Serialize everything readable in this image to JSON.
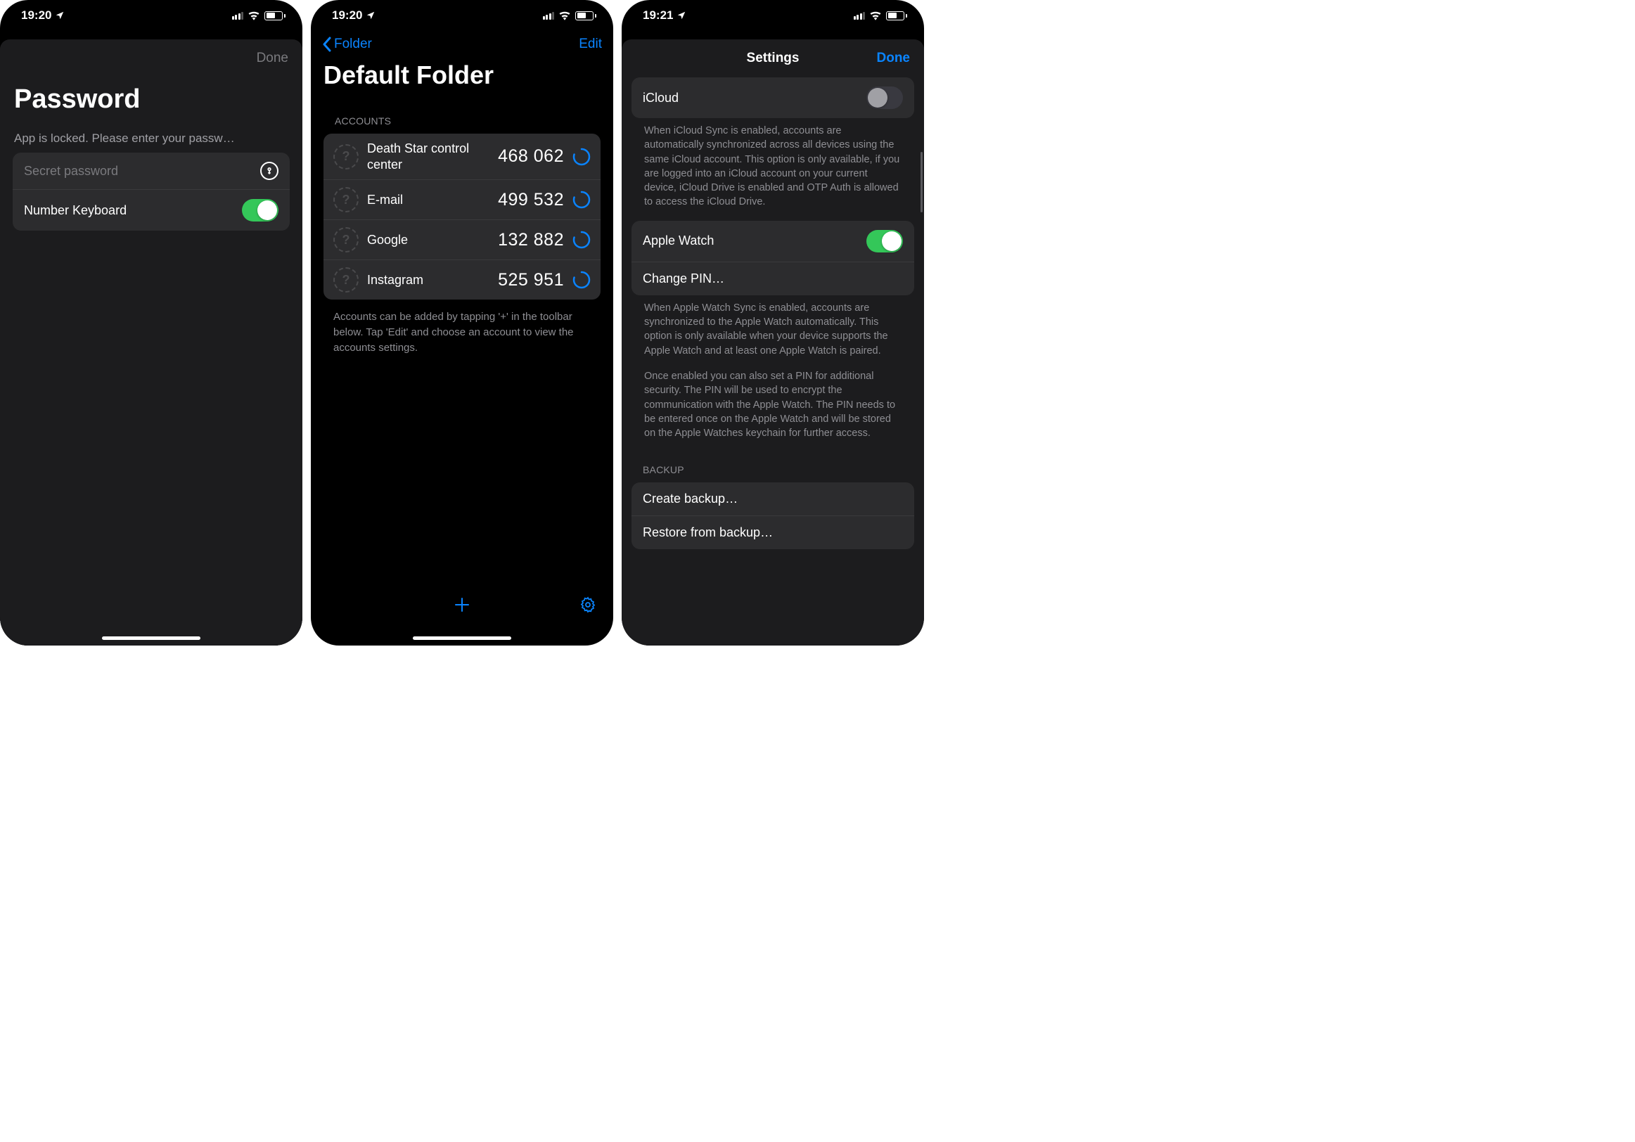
{
  "screen1": {
    "time": "19:20",
    "done": "Done",
    "title": "Password",
    "subtitle": "App is locked. Please enter your passw…",
    "placeholder": "Secret password",
    "numKeyboardLabel": "Number Keyboard"
  },
  "screen2": {
    "time": "19:20",
    "back": "Folder",
    "edit": "Edit",
    "title": "Default Folder",
    "sectionHeader": "ACCOUNTS",
    "accounts": [
      {
        "name": "Death Star control center",
        "code": "468 062"
      },
      {
        "name": "E-mail",
        "code": "499 532"
      },
      {
        "name": "Google",
        "code": "132 882"
      },
      {
        "name": "Instagram",
        "code": "525 951"
      }
    ],
    "footer": "Accounts can be added by tapping '+' in the toolbar below. Tap 'Edit' and choose an account to view the accounts settings."
  },
  "screen3": {
    "time": "19:21",
    "title": "Settings",
    "done": "Done",
    "icloudLabel": "iCloud",
    "icloudDesc": "When iCloud Sync is enabled, accounts are automatically synchronized across all devices using the same iCloud account. This option is only available, if you are logged into an iCloud account on your current device, iCloud Drive is enabled and OTP Auth is allowed to access the iCloud Drive.",
    "appleWatchLabel": "Apple Watch",
    "changePinLabel": "Change PIN…",
    "watchDesc1": "When Apple Watch Sync is enabled, accounts are synchronized to the Apple Watch automatically. This option is only available when your device supports the Apple Watch and at least one Apple Watch is paired.",
    "watchDesc2": "Once enabled you can also set a PIN for additional security. The PIN will be used to encrypt the communication with the Apple Watch. The PIN needs to be entered once on the Apple Watch and will be stored on the Apple Watches keychain for further access.",
    "backupHeader": "BACKUP",
    "createBackup": "Create backup…",
    "restoreBackup": "Restore from backup…"
  }
}
